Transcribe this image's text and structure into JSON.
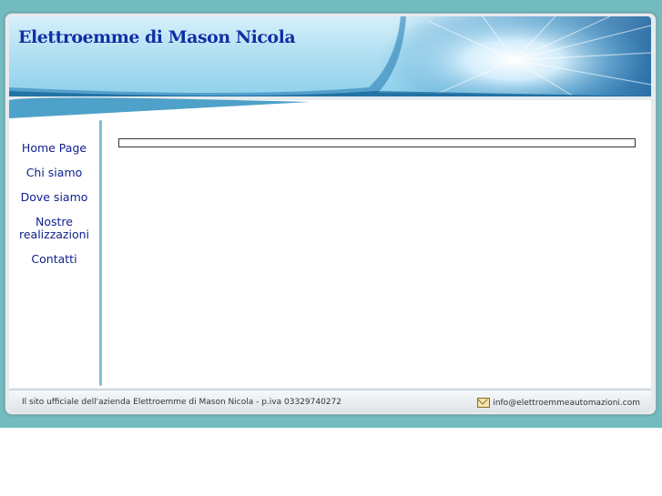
{
  "header": {
    "title": "Elettroemme di Mason Nicola"
  },
  "nav": {
    "items": [
      {
        "label": "Home Page"
      },
      {
        "label": "Chi siamo"
      },
      {
        "label": "Dove siamo"
      },
      {
        "label": "Nostre realizzazioni"
      },
      {
        "label": "Contatti"
      }
    ]
  },
  "footer": {
    "left_text": "Il sito ufficiale dell'azienda Elettroemme di Mason Nicola - p.iva 03329740272",
    "email": "info@elettroemmeautomazioni.com"
  },
  "colors": {
    "background": "#72bcc0",
    "title": "#0d2fa6",
    "nav_link": "#0d1e8a",
    "sidebar_line": "#7cc1cb"
  },
  "icons": {
    "email": "envelope-icon"
  }
}
